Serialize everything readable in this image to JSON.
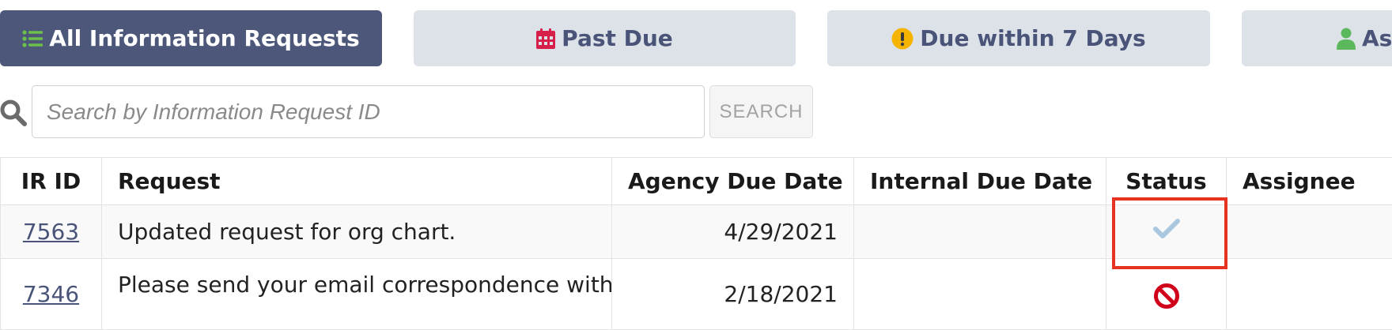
{
  "tabs": [
    {
      "label": "All Information Requests",
      "icon": "list-icon",
      "active": true
    },
    {
      "label": "Past Due",
      "icon": "calendar-icon",
      "active": false
    },
    {
      "label": "Due within 7 Days",
      "icon": "exclamation-circle-icon",
      "active": false
    },
    {
      "label": "As",
      "icon": "user-icon",
      "active": false
    }
  ],
  "search": {
    "placeholder": "Search by Information Request ID",
    "value": "",
    "button_label": "SEARCH"
  },
  "table": {
    "columns": [
      "IR ID",
      "Request",
      "Agency Due Date",
      "Internal Due Date",
      "Status",
      "Assignee"
    ],
    "rows": [
      {
        "id": "7563",
        "request": "Updated request for org chart.",
        "agency_due": "4/29/2021",
        "internal_due": "",
        "status": "check-icon",
        "assignee": ""
      },
      {
        "id": "7346",
        "request": "Please send your email correspondence with",
        "agency_due": "2/18/2021",
        "internal_due": "",
        "status": "prohibited-icon",
        "assignee": ""
      }
    ]
  },
  "colors": {
    "tab_active_bg": "#4c577a",
    "tab_bg": "#dde2e9",
    "tab_text": "#4a5478",
    "list_icon": "#6cc04a",
    "calendar_icon": "#d6204a",
    "warning_icon": "#f5b400",
    "user_icon": "#5cb85c",
    "check_icon": "#a9c8e0",
    "prohibited_icon": "#d0021b",
    "highlight_border": "#e6321e"
  }
}
